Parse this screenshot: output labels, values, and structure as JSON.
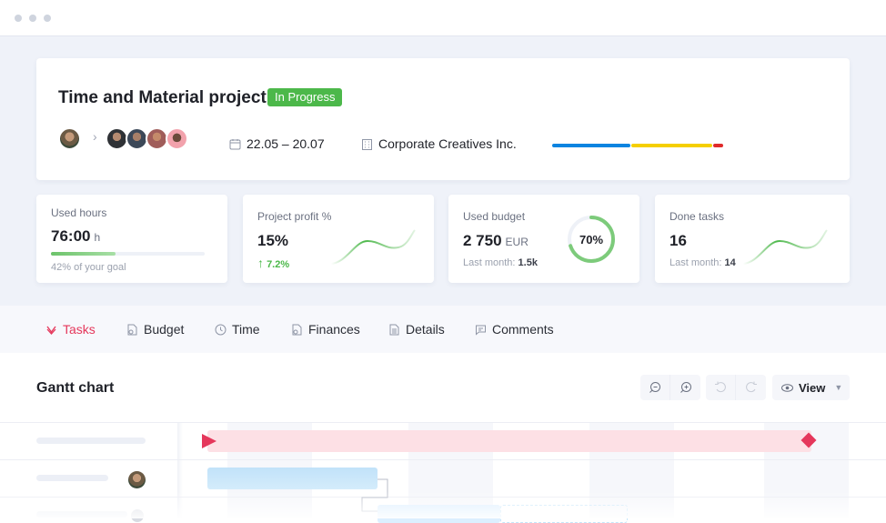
{
  "window": {
    "controls": [
      "close",
      "minimize",
      "maximize"
    ]
  },
  "project": {
    "title": "Time and Material project",
    "status": "In Progress",
    "status_color": "#4cb84a",
    "date_range": "22.05 – 20.07",
    "client": "Corporate Creatives Inc.",
    "progress_segments": [
      {
        "color": "#0a84e0",
        "share": 0.46
      },
      {
        "color": "#f5cf00",
        "share": 0.48
      },
      {
        "color": "#e02a2a",
        "share": 0.06
      }
    ],
    "owner_avatar": "owner-avatar",
    "team_avatars": [
      "member-1",
      "member-2",
      "member-3",
      "member-4"
    ]
  },
  "stats": {
    "used_hours": {
      "label": "Used hours",
      "value": "76:00",
      "unit": "h",
      "progress": 0.42,
      "note": "42% of your goal"
    },
    "project_profit": {
      "label": "Project profit %",
      "value": "15%",
      "change": "7.2%",
      "trend": "up"
    },
    "used_budget": {
      "label": "Used budget",
      "value": "2 750",
      "unit": "EUR",
      "last_month_label": "Last month:",
      "last_month": "1.5k",
      "ring_percent": 70,
      "ring_label": "70%"
    },
    "done_tasks": {
      "label": "Done tasks",
      "value": "16",
      "last_month_label": "Last month:",
      "last_month": "14"
    }
  },
  "tabs": [
    {
      "label": "Tasks",
      "icon": "tasks-icon",
      "active": true
    },
    {
      "label": "Budget",
      "icon": "budget-icon",
      "active": false
    },
    {
      "label": "Time",
      "icon": "clock-icon",
      "active": false
    },
    {
      "label": "Finances",
      "icon": "finances-icon",
      "active": false
    },
    {
      "label": "Details",
      "icon": "document-icon",
      "active": false
    },
    {
      "label": "Comments",
      "icon": "comment-icon",
      "active": false
    }
  ],
  "gantt": {
    "title": "Gantt chart",
    "toolbar": {
      "zoom_out": "zoom-out-icon",
      "zoom_in": "zoom-in-icon",
      "undo": "undo-icon",
      "redo": "redo-icon",
      "view_label": "View"
    }
  },
  "colors": {
    "accent": "#e5375b",
    "milestone_bar": "#fde0e5",
    "task_bar": "#c4e5fa"
  }
}
